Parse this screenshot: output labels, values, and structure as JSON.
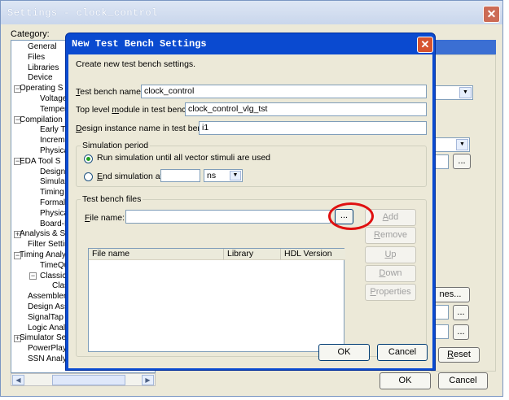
{
  "outer": {
    "title": "Settings - clock_control",
    "category_label": "Category:",
    "tree": [
      {
        "label": "General",
        "indent": 1,
        "box": ""
      },
      {
        "label": "Files",
        "indent": 1,
        "box": ""
      },
      {
        "label": "Libraries",
        "indent": 1,
        "box": ""
      },
      {
        "label": "Device",
        "indent": 1,
        "box": ""
      },
      {
        "label": "Operating S",
        "indent": 0,
        "box": "−"
      },
      {
        "label": "Voltage",
        "indent": 2,
        "box": ""
      },
      {
        "label": "Temper",
        "indent": 2,
        "box": ""
      },
      {
        "label": "Compilation",
        "indent": 0,
        "box": "−"
      },
      {
        "label": "Early Tin",
        "indent": 2,
        "box": ""
      },
      {
        "label": "Increme",
        "indent": 2,
        "box": ""
      },
      {
        "label": "Physica",
        "indent": 2,
        "box": ""
      },
      {
        "label": "EDA Tool S",
        "indent": 0,
        "box": "−"
      },
      {
        "label": "Design",
        "indent": 2,
        "box": ""
      },
      {
        "label": "Simulati",
        "indent": 2,
        "box": ""
      },
      {
        "label": "Timing A",
        "indent": 2,
        "box": ""
      },
      {
        "label": "Formal V",
        "indent": 2,
        "box": ""
      },
      {
        "label": "Physica",
        "indent": 2,
        "box": ""
      },
      {
        "label": "Board-L",
        "indent": 2,
        "box": ""
      },
      {
        "label": "Analysis & S",
        "indent": 0,
        "box": "+"
      },
      {
        "label": "Filter Setting",
        "indent": 1,
        "box": ""
      },
      {
        "label": "Timing Analy",
        "indent": 0,
        "box": "−"
      },
      {
        "label": "TimeQu",
        "indent": 2,
        "box": ""
      },
      {
        "label": "Classic",
        "indent": 2,
        "box": "−"
      },
      {
        "label": "Clas",
        "indent": 3,
        "box": ""
      },
      {
        "label": "Assembler",
        "indent": 1,
        "box": ""
      },
      {
        "label": "Design Assi",
        "indent": 1,
        "box": ""
      },
      {
        "label": "SignalTap II",
        "indent": 1,
        "box": ""
      },
      {
        "label": "Logic Analy",
        "indent": 1,
        "box": ""
      },
      {
        "label": "Simulator Se",
        "indent": 0,
        "box": "+"
      },
      {
        "label": "PowerPlay P",
        "indent": 1,
        "box": ""
      },
      {
        "label": "SSN Analyz",
        "indent": 1,
        "box": ""
      }
    ],
    "nes_button": "nes...",
    "ellipsis": "...",
    "reset_button": "Reset",
    "ok_button": "OK",
    "cancel_button": "Cancel"
  },
  "dialog": {
    "title": "New Test Bench Settings",
    "description": "Create new test bench settings.",
    "test_bench_name_label": "Test bench name:",
    "test_bench_name_value": "clock_control",
    "top_level_label": "Top level module in test bench:",
    "top_level_value": "clock_control_vlg_tst",
    "instance_label": "Design instance name in test bench:",
    "instance_value": "i1",
    "sim_period_title": "Simulation period",
    "run_until_label": "Run simulation until all vector stimuli are used",
    "end_sim_label": "End simulation at:",
    "end_sim_value": "",
    "end_sim_unit": "ns",
    "files_group_title": "Test bench files",
    "file_name_label": "File name:",
    "file_name_value": "",
    "browse_button": "...",
    "columns": [
      "File name",
      "Library",
      "HDL Version"
    ],
    "add_button": "Add",
    "remove_button": "Remove",
    "up_button": "Up",
    "down_button": "Down",
    "properties_button": "Properties",
    "ok_button": "OK",
    "cancel_button": "Cancel"
  },
  "colors": {
    "title_bar": "#0a4ad0",
    "dialog_face": "#ece9d8",
    "highlight_circle": "#e01010"
  }
}
